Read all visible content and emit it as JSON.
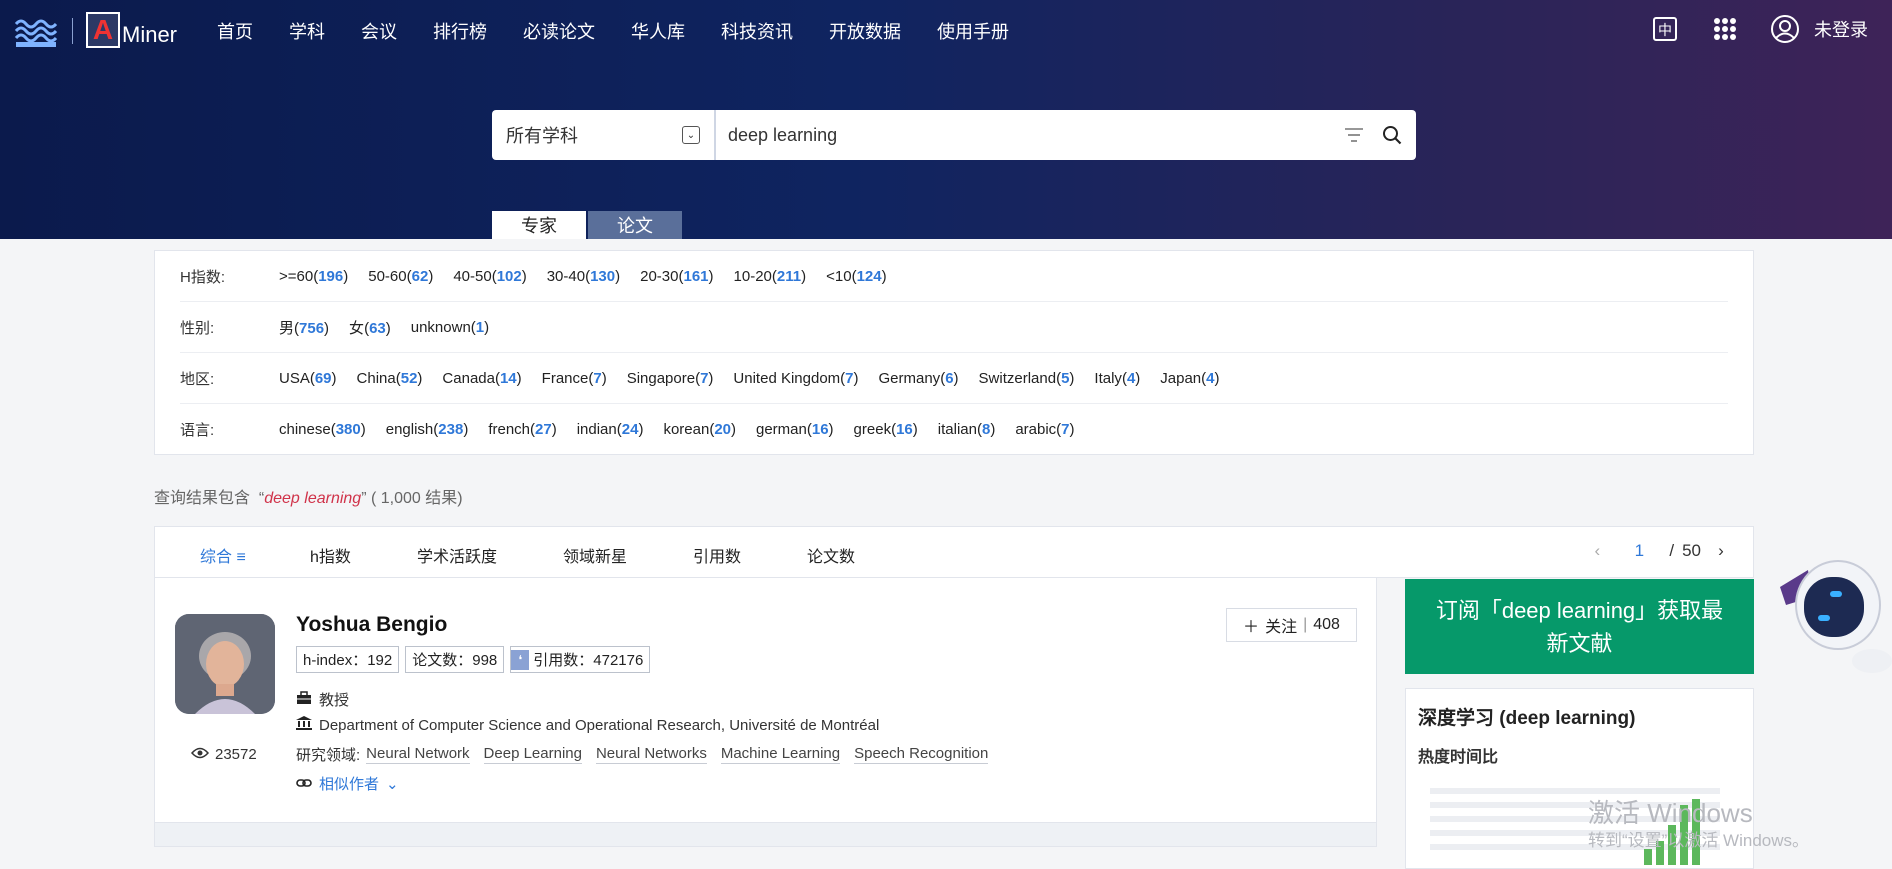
{
  "nav": {
    "items": [
      "首页",
      "学科",
      "会议",
      "排行榜",
      "必读论文",
      "华人库",
      "科技资讯",
      "开放数据",
      "使用手册"
    ],
    "login": "未登录",
    "logo_text": "Miner"
  },
  "search": {
    "scope": "所有学科",
    "query": "deep learning"
  },
  "tabs": {
    "expert": "专家",
    "paper": "论文"
  },
  "filters": {
    "hindex": {
      "label": "H指数:",
      "options": [
        {
          "name": ">=60",
          "count": "196"
        },
        {
          "name": "50-60",
          "count": "62"
        },
        {
          "name": "40-50",
          "count": "102"
        },
        {
          "name": "30-40",
          "count": "130"
        },
        {
          "name": "20-30",
          "count": "161"
        },
        {
          "name": "10-20",
          "count": "211"
        },
        {
          "name": "<10",
          "count": "124"
        }
      ]
    },
    "gender": {
      "label": "性别:",
      "options": [
        {
          "name": "男",
          "count": "756"
        },
        {
          "name": "女",
          "count": "63"
        },
        {
          "name": "unknown",
          "count": "1"
        }
      ]
    },
    "region": {
      "label": "地区:",
      "options": [
        {
          "name": "USA",
          "count": "69"
        },
        {
          "name": "China",
          "count": "52"
        },
        {
          "name": "Canada",
          "count": "14"
        },
        {
          "name": "France",
          "count": "7"
        },
        {
          "name": "Singapore",
          "count": "7"
        },
        {
          "name": "United Kingdom",
          "count": "7"
        },
        {
          "name": "Germany",
          "count": "6"
        },
        {
          "name": "Switzerland",
          "count": "5"
        },
        {
          "name": "Italy",
          "count": "4"
        },
        {
          "name": "Japan",
          "count": "4"
        }
      ]
    },
    "language": {
      "label": "语言:",
      "options": [
        {
          "name": "chinese",
          "count": "380"
        },
        {
          "name": "english",
          "count": "238"
        },
        {
          "name": "french",
          "count": "27"
        },
        {
          "name": "indian",
          "count": "24"
        },
        {
          "name": "korean",
          "count": "20"
        },
        {
          "name": "german",
          "count": "16"
        },
        {
          "name": "greek",
          "count": "16"
        },
        {
          "name": "italian",
          "count": "8"
        },
        {
          "name": "arabic",
          "count": "7"
        }
      ]
    }
  },
  "results": {
    "prefix": "查询结果包含",
    "open_quote": "“",
    "query": "deep learning",
    "close_quote": "”",
    "count": "( 1,000 结果)"
  },
  "sort": {
    "options": [
      "综合",
      "h指数",
      "学术活跃度",
      "领域新星",
      "引用数",
      "论文数"
    ],
    "active_icon": "≡"
  },
  "pager": {
    "current": "1",
    "sep": "/",
    "total": "50"
  },
  "person": {
    "name": "Yoshua Bengio",
    "hindex": "h-index：192",
    "papers": "论文数：998",
    "citations": "引用数：472176",
    "follow_label": "关注",
    "follow_count": "408",
    "title": "教授",
    "affiliation": "Department of Computer Science and Operational Research, Université de Montréal",
    "fields_label": "研究领域:",
    "fields": [
      "Neural Network",
      "Deep Learning",
      "Neural Networks",
      "Machine Learning",
      "Speech Recognition"
    ],
    "similar": "相似作者",
    "views": "23572"
  },
  "sidebar": {
    "subscribe": "订阅「deep learning」获取最新文献",
    "topic_title": "深度学习 (deep learning)",
    "topic_sub": "热度时间比"
  },
  "watermark": {
    "line1": "激活 Windows",
    "line2": "转到“设置”以激活 Windows。"
  },
  "colors": {
    "accent": "#2f78d8",
    "green": "#06996a",
    "hero": "#0f2460"
  }
}
